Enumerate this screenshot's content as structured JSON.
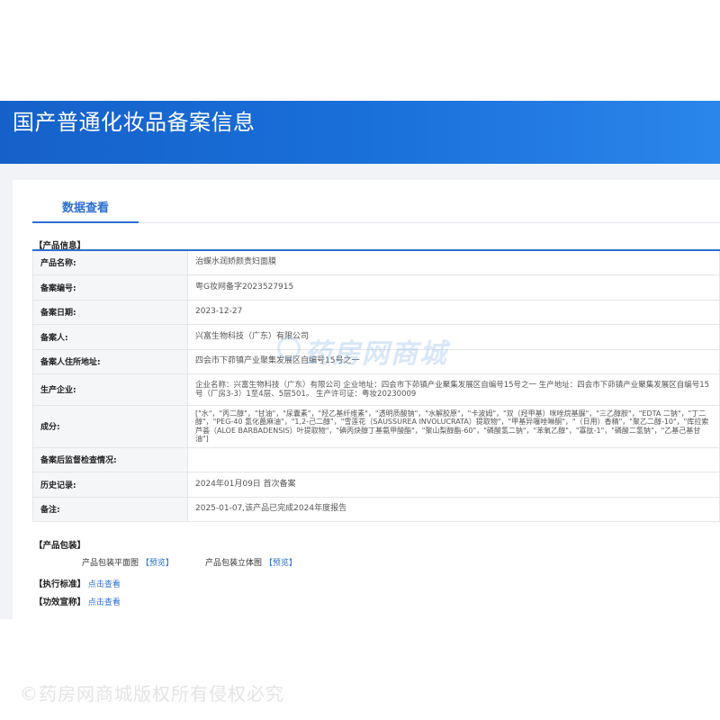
{
  "banner": {
    "title": "国产普通化妆品备案信息"
  },
  "tabs": {
    "active": "数据查看"
  },
  "product_info": {
    "section_title": "【产品信息】",
    "rows": [
      {
        "label": "产品名称:",
        "value": "治蝶水润娇颜贵妇面膜"
      },
      {
        "label": "备案编号:",
        "value": "粤G妆网备字2023527915"
      },
      {
        "label": "备案日期:",
        "value": "2023-12-27"
      },
      {
        "label": "备案人:",
        "value": "兴富生物科技（广东）有限公司"
      },
      {
        "label": "备案人住所地址:",
        "value": "四会市下茆镇产业聚集发展区自编号15号之一"
      },
      {
        "label": "生产企业:",
        "value": "企业名称：兴富生物科技（广东）有限公司 企业地址：四会市下茆镇产业聚集发展区自编号15号之一 生产地址：四会市下茆镇产业聚集发展区自编号15号（厂房3-3）1至4层、5层501。 生产许可证：粤妆20230009"
      },
      {
        "label": "成分:",
        "value": "[\"水\"，\"丙二醇\"，\"甘油\"，\"尿囊素\"，\"羟乙基纤维素\"，\"透明质酸钠\"，\"水解胶原\"，\"卡波姆\"，\"双（羟甲基）咪唑烷基脲\"，\"三乙醇胺\"，\"EDTA 二钠\"，\"丁二醇\"，\"PEG-40 氢化蓖麻油\"，\"1,2-己二醇\"，\"雪莲花（SAUSSUREA INVOLUCRATA）提取物\"，\"甲基异噻唑啉酮\"，\"（日用）香精\"，\"聚乙二醇-10\"，\"库拉索芦荟（ALOE BARBADENSIS）叶提取物\"，\"碘丙炔醇丁基氨甲酸酯\"，\"聚山梨醇酯-60\"，\"磷酸氢二钠\"，\"苯氧乙醇\"，\"寡肽-1\"，\"磷酸二氢钠\"，\"乙基己基甘油\"]"
      },
      {
        "label": "备案后监督检查情况:",
        "value": ""
      },
      {
        "label": "历史记录:",
        "value": "2024年01月09日 首次备案"
      },
      {
        "label": "备注:",
        "value": "2025-01-07,该产品已完成2024年度报告"
      }
    ]
  },
  "packaging": {
    "section_title": "【产品包装】",
    "flat_label": "产品包装平面图",
    "flat_link": "【预览】",
    "solid_label": "产品包装立体图",
    "solid_link": "【预览】"
  },
  "standard": {
    "section_title": "【执行标准】",
    "link": "点击查看"
  },
  "efficacy": {
    "section_title": "【功效宣称】",
    "link": "点击查看"
  },
  "watermarks": {
    "middle": "药房网商城",
    "bottom": "©药房网商城版权所有侵权必究"
  }
}
